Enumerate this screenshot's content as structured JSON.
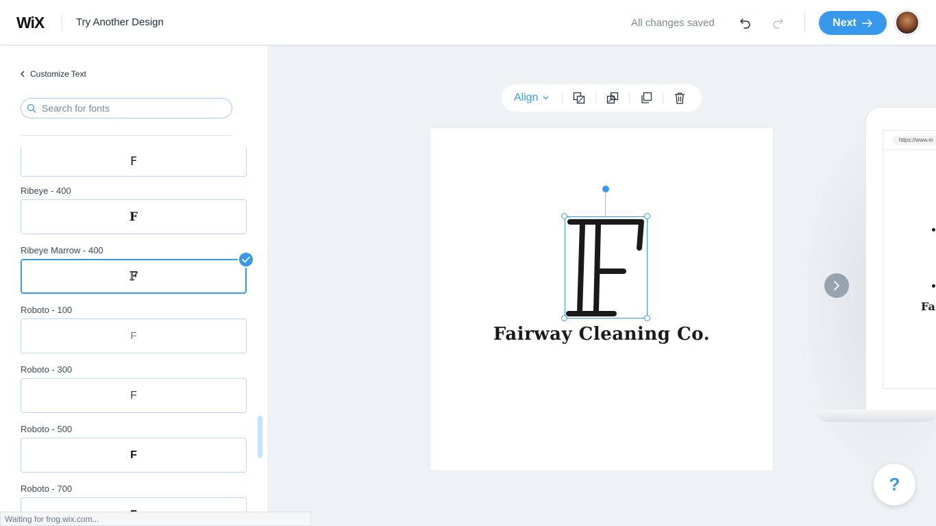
{
  "header": {
    "logo": "WiX",
    "title": "Try Another Design",
    "save_status": "All changes saved",
    "undo_icon": "undo-icon",
    "redo_icon": "redo-icon",
    "next_label": "Next",
    "avatar": "user-avatar"
  },
  "panel": {
    "back_label": "Customize Text",
    "search": {
      "placeholder": "Search for fonts",
      "value": ""
    },
    "fonts": [
      {
        "name": "",
        "sample": "F",
        "selected": false
      },
      {
        "name": "Ribeye - 400",
        "sample": "F",
        "selected": false
      },
      {
        "name": "Ribeye Marrow - 400",
        "sample": "F",
        "selected": true
      },
      {
        "name": "Roboto - 100",
        "sample": "F",
        "selected": false
      },
      {
        "name": "Roboto - 300",
        "sample": "F",
        "selected": false
      },
      {
        "name": "Roboto - 500",
        "sample": "F",
        "selected": false
      },
      {
        "name": "Roboto - 700",
        "sample": "F",
        "selected": false
      }
    ]
  },
  "toolbar": {
    "align_label": "Align",
    "icons": [
      "bring-forward-icon",
      "send-backward-icon",
      "duplicate-icon",
      "delete-icon"
    ]
  },
  "canvas": {
    "logo_letter": "F",
    "brand_name": "Fairway Cleaning Co."
  },
  "preview": {
    "url": "https://www.m",
    "text": "Fa"
  },
  "status_bar": "Waiting for frog.wix.com...",
  "help_label": "?",
  "colors": {
    "accent": "#3899ec",
    "background": "#eff2f5"
  }
}
